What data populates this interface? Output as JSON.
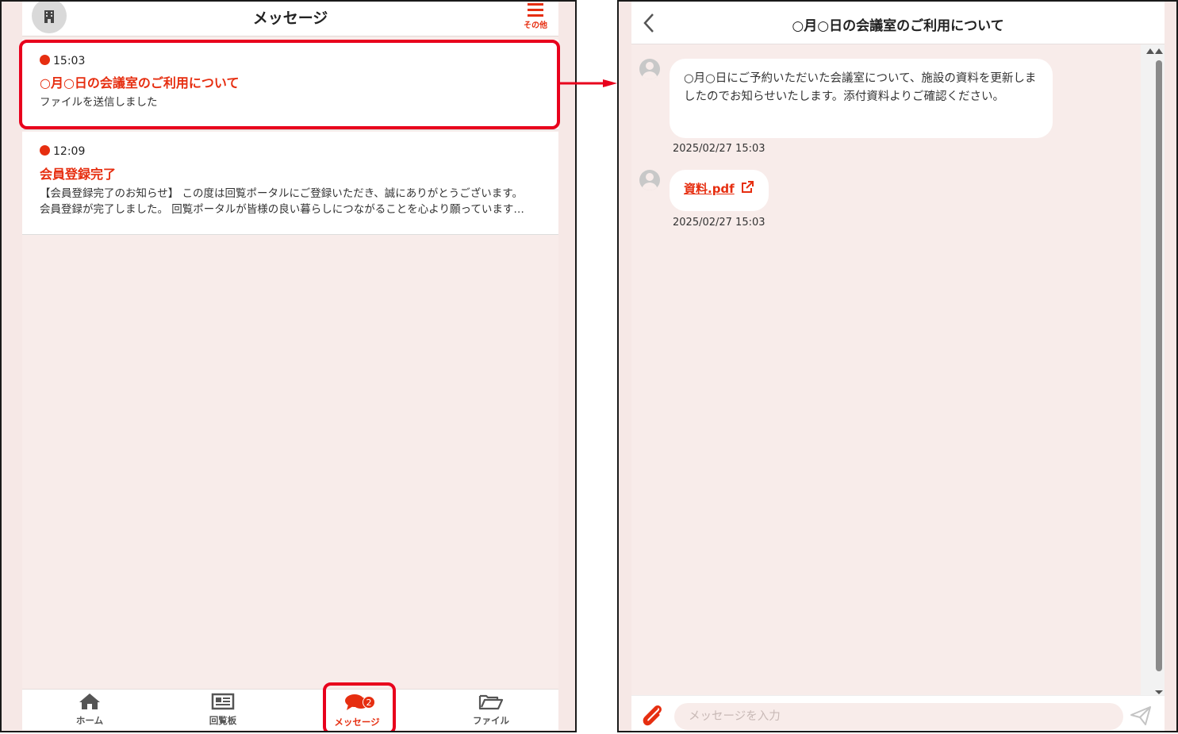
{
  "left": {
    "header": {
      "title": "メッセージ",
      "menu_label": "その他"
    },
    "messages": [
      {
        "time": "15:03",
        "title": "○月○日の会議室のご利用について",
        "preview": "ファイルを送信しました"
      },
      {
        "time": "12:09",
        "title": "会員登録完了",
        "preview_line1": "【会員登録完了のお知らせ】 この度は回覧ポータルにご登録いただき、誠にありがとうございます。",
        "preview_line2": "会員登録が完了しました。 回覧ポータルが皆様の良い暮らしにつながることを心より願っています…"
      }
    ],
    "nav": [
      {
        "label": "ホーム",
        "icon": "home-icon"
      },
      {
        "label": "回覧板",
        "icon": "newspaper-icon"
      },
      {
        "label": "メッセージ",
        "icon": "chat-bubbles-icon",
        "badge": "2"
      },
      {
        "label": "ファイル",
        "icon": "folder-open-icon"
      }
    ]
  },
  "right": {
    "header": {
      "title": "○月○日の会議室のご利用について"
    },
    "chat": [
      {
        "text": "○月○日にご予約いただいた会議室について、施設の資料を更新しましたのでお知らせいたします。添付資料よりご確認ください。",
        "time": "2025/02/27 15:03"
      },
      {
        "file": "資料.pdf",
        "time": "2025/02/27 15:03"
      }
    ],
    "input": {
      "placeholder": "メッセージを入力"
    }
  },
  "colors": {
    "accent": "#e62e10",
    "highlight": "#e8001c",
    "background": "#f8ecea"
  }
}
